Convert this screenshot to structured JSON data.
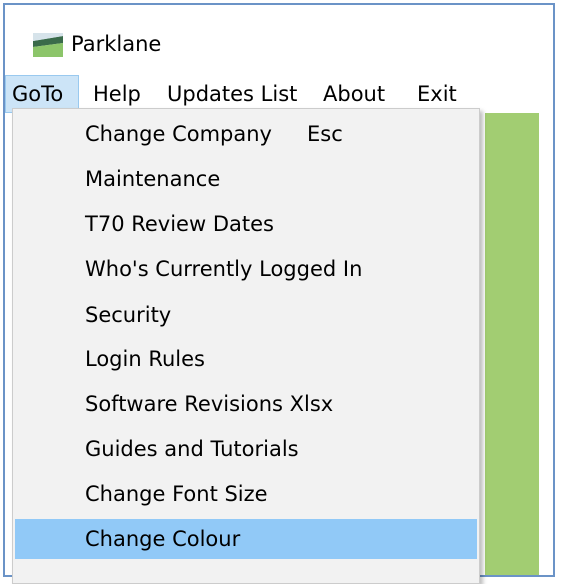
{
  "window": {
    "title": "Parklane",
    "icon": "app-icon"
  },
  "menubar": {
    "items": [
      {
        "label": "GoTo"
      },
      {
        "label": "Help"
      },
      {
        "label": "Updates List"
      },
      {
        "label": "About"
      },
      {
        "label": "Exit"
      }
    ]
  },
  "dropdown": {
    "items": [
      {
        "label": "Change Company",
        "shortcut": "Esc"
      },
      {
        "label": "Maintenance"
      },
      {
        "label": "T70 Review Dates"
      },
      {
        "label": "Who's Currently Logged In"
      },
      {
        "label": "Security"
      },
      {
        "label": "Login Rules"
      },
      {
        "label": "Software Revisions Xlsx"
      },
      {
        "label": "Guides and Tutorials"
      },
      {
        "label": "Change Font Size"
      },
      {
        "label": "Change Colour"
      }
    ],
    "highlighted_item": "Change Colour"
  },
  "colors": {
    "background_accent": "#a2cd72",
    "menu_highlight": "#91c9f7",
    "active_menu": "#cce4f7"
  }
}
